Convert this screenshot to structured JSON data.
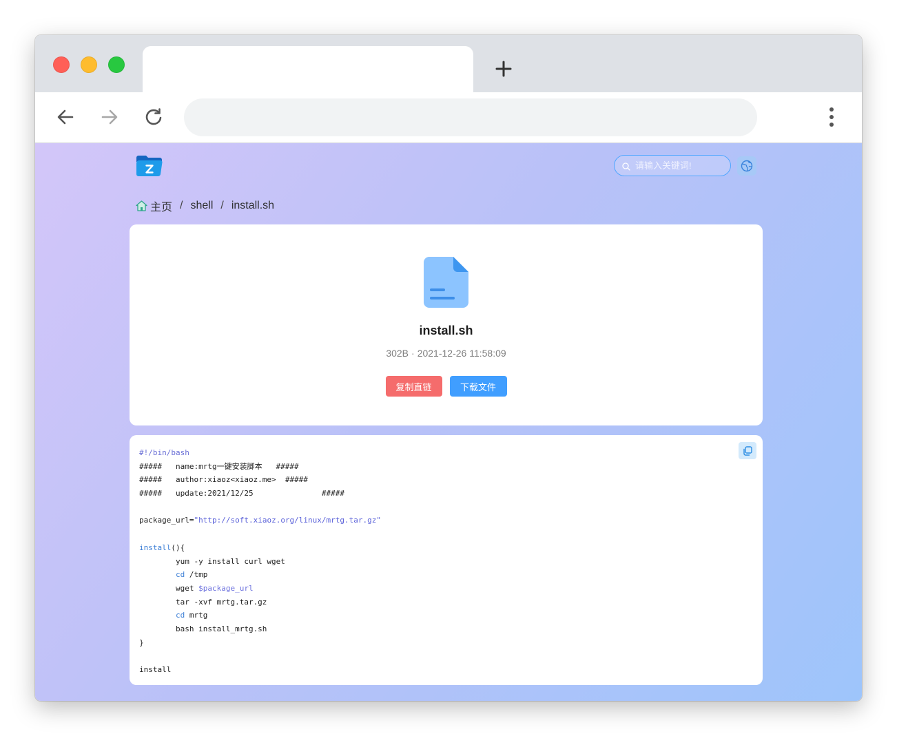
{
  "browser": {
    "icons": {
      "back": "arrow-left-icon",
      "forward": "arrow-right-icon",
      "reload": "reload-icon",
      "new_tab": "plus-icon",
      "menu": "more-vertical-icon"
    }
  },
  "logo": {
    "icon": "folder-logo-icon",
    "lettering": "Z"
  },
  "header": {
    "search_placeholder": "请输入关键词!",
    "search_icon": "search-icon",
    "language_icon": "globe-icon"
  },
  "breadcrumb": {
    "home_icon": "home-icon",
    "separator": "/",
    "items": [
      "主页",
      "shell",
      "install.sh"
    ]
  },
  "file": {
    "icon": "file-document-icon",
    "name": "install.sh",
    "size": "302B",
    "meta_separator": "·",
    "modified": "2021-12-26 11:58:09"
  },
  "actions": {
    "copy_link": "复制直链",
    "download": "下载文件"
  },
  "code": {
    "copy_icon": "copy-icon",
    "lines": [
      [
        {
          "text": "#!/bin/bash",
          "color": "#6a6fd6"
        }
      ],
      [
        {
          "text": "#####   name:mrtg一键安装脚本   #####"
        }
      ],
      [
        {
          "text": "#####   author:xiaoz<xiaoz.me>  #####"
        }
      ],
      [
        {
          "text": "#####   update:2021/12/25               #####"
        }
      ],
      [],
      [
        {
          "text": "package_url="
        },
        {
          "text": "\"http://soft.xiaoz.org/linux/mrtg.tar.gz\"",
          "color": "#5b62d9"
        }
      ],
      [],
      [
        {
          "text": "install",
          "color": "#3d7fd6"
        },
        {
          "text": "(){"
        }
      ],
      [
        {
          "text": "        yum -y install curl wget"
        }
      ],
      [
        {
          "text": "        "
        },
        {
          "text": "cd",
          "color": "#3d7fd6"
        },
        {
          "text": " /tmp"
        }
      ],
      [
        {
          "text": "        wget "
        },
        {
          "text": "$package_url",
          "color": "#6d72de"
        }
      ],
      [
        {
          "text": "        tar -xvf mrtg.tar.gz"
        }
      ],
      [
        {
          "text": "        "
        },
        {
          "text": "cd",
          "color": "#3d7fd6"
        },
        {
          "text": " mrtg"
        }
      ],
      [
        {
          "text": "        bash install_mrtg.sh"
        }
      ],
      [
        {
          "text": "}"
        }
      ],
      [],
      [
        {
          "text": "install"
        }
      ]
    ]
  },
  "colors": {
    "primary": "#409eff",
    "danger": "#f56c6c",
    "bg_start": "#d3c6f9",
    "bg_mid": "#b9c1f8",
    "bg_end": "#9ec5fb",
    "traffic_red": "#ff5f57",
    "traffic_yellow": "#febc2e",
    "traffic_green": "#28c840"
  }
}
